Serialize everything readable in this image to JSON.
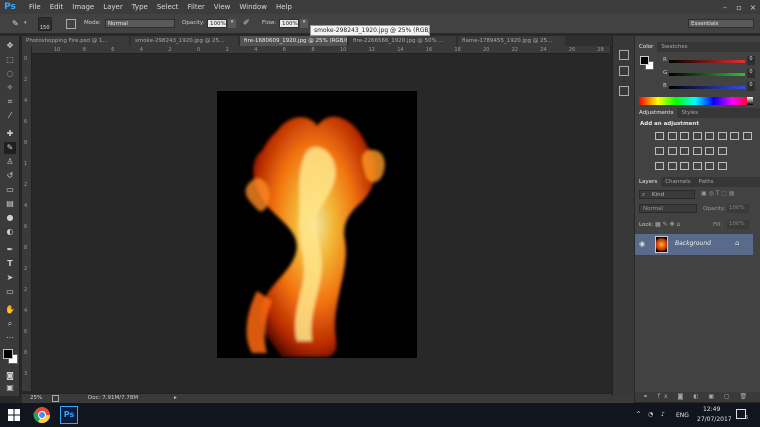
{
  "menu": {
    "logo": "Ps",
    "items": [
      "File",
      "Edit",
      "Image",
      "Layer",
      "Type",
      "Select",
      "Filter",
      "View",
      "Window",
      "Help"
    ]
  },
  "options": {
    "brush_size": "150",
    "mode_label": "Mode:",
    "mode_value": "Normal",
    "opacity_label": "Opacity:",
    "opacity_value": "100%",
    "flow_label": "Flow:",
    "flow_value": "100%",
    "workspace": "Essentials"
  },
  "tooltip": "smoke-298243_1920.jpg @ 25% (RGB/8#)",
  "tabs": [
    {
      "label": "Photoshopping Fire.psd @ 1...",
      "active": false
    },
    {
      "label": "smoke-298243_1920.jpg @ 25...",
      "active": false
    },
    {
      "label": "fire-1680609_1920.jpg @ 25% (RGB/8#)",
      "active": true
    },
    {
      "label": "fire-2266566_1920.jpg @ 50% ...",
      "active": false
    },
    {
      "label": "flame-1789455_1920.jpg @ 25...",
      "active": false
    }
  ],
  "ruler": {
    "h": [
      "10",
      "8",
      "6",
      "4",
      "2",
      "0",
      "2",
      "4",
      "6",
      "8",
      "10",
      "12",
      "14",
      "16",
      "18",
      "20",
      "22",
      "24",
      "26",
      "28"
    ],
    "v": [
      "0",
      "2",
      "4",
      "6",
      "8",
      "1",
      "2",
      "4",
      "6",
      "8",
      "2",
      "2",
      "4",
      "6",
      "8",
      "3"
    ]
  },
  "status": {
    "zoom": "25%",
    "doc": "Doc: 7.91M/7.78M"
  },
  "color_panel": {
    "tabs": [
      "Color",
      "Swatches"
    ],
    "channels": [
      {
        "label": "R",
        "value": "0",
        "color": "#e53030"
      },
      {
        "label": "G",
        "value": "0",
        "color": "#30c030"
      },
      {
        "label": "B",
        "value": "0",
        "color": "#3050e0"
      }
    ]
  },
  "adjustments_panel": {
    "tabs": [
      "Adjustments",
      "Styles"
    ],
    "heading": "Add an adjustment"
  },
  "layers_panel": {
    "tabs": [
      "Layers",
      "Channels",
      "Paths"
    ],
    "kind_label": "Kind",
    "blend_mode": "Normal",
    "opacity_label": "Opacity:",
    "opacity_value": "100%",
    "lock_label": "Lock:",
    "fill_label": "Fill:",
    "fill_value": "100%",
    "layer_name": "Background"
  },
  "taskbar": {
    "lang": "ENG",
    "time": "12:49",
    "date": "27/07/2017",
    "notif": "5"
  }
}
